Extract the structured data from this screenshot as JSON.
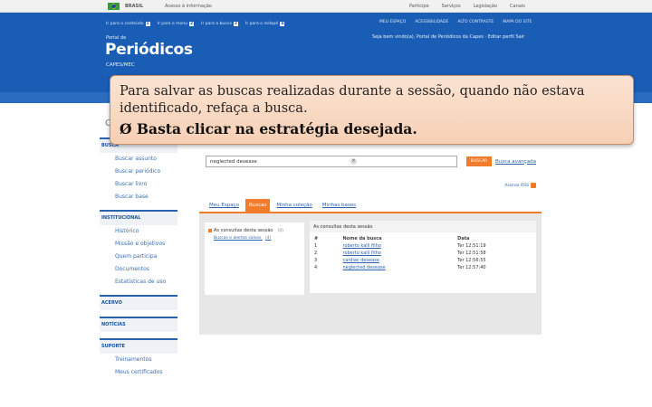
{
  "govbar": {
    "country": "BRASIL",
    "access_info": "Acesso à informação",
    "links": [
      "Participe",
      "Serviços",
      "Legislação",
      "Canais"
    ]
  },
  "header": {
    "shortcuts": [
      {
        "label": "Ir para o conteúdo",
        "key": "1"
      },
      {
        "label": "Ir para o menu",
        "key": "2"
      },
      {
        "label": "Ir para a busca",
        "key": "3"
      },
      {
        "label": "Ir para o rodapé",
        "key": "4"
      }
    ],
    "portal_small": "Portal de",
    "portal_big": "Periódicos",
    "capes": "CAPES/MEC",
    "top_links": [
      "MEU ESPAÇO",
      "ACESSIBILIDADE",
      "ALTO CONTRASTE",
      "MAPA DO SITE"
    ],
    "welcome": "Seja bem vindo(a), Portal de Periódicos da Capes · Editar perfil  Sair"
  },
  "overlay": {
    "line1": "Para salvar as buscas realizadas durante a sessão, quando não estava identificado, refaça a busca.",
    "bullet": "Ø",
    "line2": "Basta clicar na estratégia desejada."
  },
  "sidebar": {
    "c_letter": "C",
    "busca_head": "BUSCA",
    "busca_items": [
      "Buscar assunto",
      "Buscar periódico",
      "Buscar livro",
      "Buscar base"
    ],
    "inst_head": "INSTITUCIONAL",
    "inst_items": [
      "Histórico",
      "Missão e objetivos",
      "Quem participa",
      "Documentos",
      "Estatísticas de uso"
    ],
    "acervo_head": "ACERVO",
    "noticias_head": "NOTÍCIAS",
    "suporte_head": "SUPORTE",
    "suporte_items": [
      "Treinamentos",
      "Meus certificados"
    ]
  },
  "main": {
    "search_value": "neglected desease",
    "search_button": "BUSCAR",
    "advanced_link": "Busca avançada",
    "rss_link": "Assinar RSS",
    "tabs": [
      "Meu Espaço",
      "Buscas",
      "Minha coleção",
      "Minhas bases"
    ],
    "left_box": {
      "title": "As consultas desta sessão",
      "title_count": "(4)",
      "item": "Buscas e alertas salvos",
      "item_count": "(4)"
    },
    "right_box": {
      "heading": "As consultas desta sessão",
      "columns": [
        "#",
        "Nome da busca",
        "Data"
      ],
      "rows": [
        {
          "n": "1",
          "name": "roberto kalil filho",
          "date": "Ter 12:51:19"
        },
        {
          "n": "2",
          "name": "roberto kalil filho",
          "date": "Ter 12:51:58"
        },
        {
          "n": "3",
          "name": "cardiac desease",
          "date": "Ter 12:56:55"
        },
        {
          "n": "4",
          "name": "neglected desease",
          "date": "Ter 12:57:40"
        }
      ]
    }
  }
}
